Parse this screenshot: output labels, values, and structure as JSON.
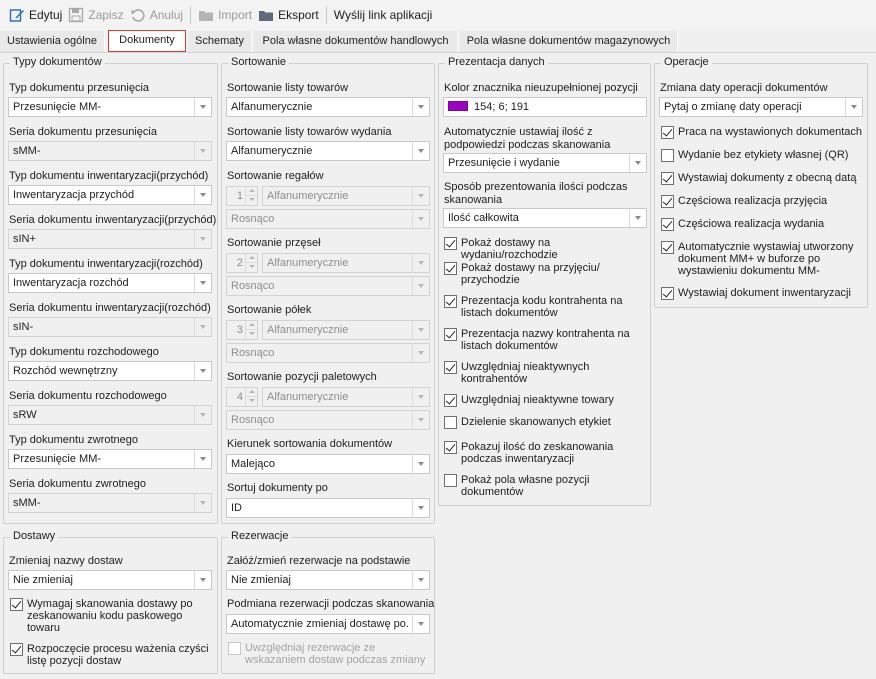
{
  "toolbar": {
    "edit": "Edytuj",
    "save": "Zapisz",
    "cancel": "Anuluj",
    "import": "Import",
    "export": "Eksport",
    "send_link": "Wyślij link aplikacji"
  },
  "tabs": [
    "Ustawienia ogólne",
    "Dokumenty",
    "Schematy",
    "Pola własne dokumentów handlowych",
    "Pola własne dokumentów magazynowych"
  ],
  "typy": {
    "legend": "Typy dokumentów",
    "f0": {
      "label": "Typ dokumentu przesunięcia",
      "value": "Przesunięcie MM-"
    },
    "f1": {
      "label": "Seria dokumentu przesunięcia",
      "value": "sMM-"
    },
    "f2": {
      "label": "Typ dokumentu inwentaryzacji(przychód)",
      "value": "Inwentaryzacja przychód"
    },
    "f3": {
      "label": "Seria dokumentu inwentaryzacji(przychód)",
      "value": "sIN+"
    },
    "f4": {
      "label": "Typ dokumentu inwentaryzacji(rozchód)",
      "value": "Inwentaryzacja rozchód"
    },
    "f5": {
      "label": "Seria dokumentu inwentaryzacji(rozchód)",
      "value": "sIN-"
    },
    "f6": {
      "label": "Typ dokumentu rozchodowego",
      "value": "Rozchód wewnętrzny"
    },
    "f7": {
      "label": "Seria dokumentu rozchodowego",
      "value": "sRW"
    },
    "f8": {
      "label": "Typ dokumentu zwrotnego",
      "value": "Przesunięcie MM-"
    },
    "f9": {
      "label": "Seria dokumentu zwrotnego",
      "value": "sMM-"
    }
  },
  "sort": {
    "legend": "Sortowanie",
    "l0": "Sortowanie listy towarów",
    "v0": "Alfanumerycznie",
    "l1": "Sortowanie listy towarów wydania",
    "v1": "Alfanumerycznie",
    "l2": "Sortowanie regałów",
    "n2": "1",
    "v2": "Alfanumerycznie",
    "o2": "Rosnąco",
    "l3": "Sortowanie przęseł",
    "n3": "2",
    "v3": "Alfanumerycznie",
    "o3": "Rosnąco",
    "l4": "Sortowanie półek",
    "n4": "3",
    "v4": "Alfanumerycznie",
    "o4": "Rosnąco",
    "l5": "Sortowanie pozycji paletowych",
    "n5": "4",
    "v5": "Alfanumerycznie",
    "o5": "Rosnąco",
    "l6": "Kierunek sortowania dokumentów",
    "v6": "Malejąco",
    "l7": "Sortuj dokumenty po",
    "v7": "ID"
  },
  "prez": {
    "legend": "Prezentacja danych",
    "color_label": "Kolor znacznika nieuzupełnionej pozycji",
    "color_value": "154; 6; 191",
    "color_hex": "#9a06bf",
    "auto_label": "Automatycznie ustawiaj ilość z podpowiedzi podczas skanowania",
    "auto_value": "Przesunięcie i wydanie",
    "qty_label": "Sposób prezentowania ilości podczas skanowania",
    "qty_value": "Ilość całkowita",
    "c0": "Pokaż dostawy na wydaniu/rozchodzie",
    "c1": "Pokaż dostawy na przyjęciu/ przychodzie",
    "c2": "Prezentacja kodu kontrahenta na listach dokumentów",
    "c3": "Prezentacja nazwy kontrahenta na listach dokumentów",
    "c4": "Uwzględniaj nieaktywnych kontrahentów",
    "c5": "Uwzględniaj nieaktywne towary",
    "c6": "Dzielenie skanowanych etykiet",
    "c7": "Pokazuj ilość do zeskanowania podczas inwentaryzacji",
    "c8": "Pokaż pola własne pozycji dokumentów"
  },
  "oper": {
    "legend": "Operacje",
    "date_label": "Zmiana daty operacji dokumentów",
    "date_value": "Pytaj o zmianę daty operacji",
    "c0": "Praca na wystawionych dokumentach",
    "c1": "Wydanie bez etykiety własnej (QR)",
    "c2": "Wystawiaj dokumenty z obecną datą",
    "c3": "Częściowa realizacja przyjęcia",
    "c4": "Częściowa realizacja wydania",
    "c5": "Automatycznie wystawiaj utworzony dokument MM+ w buforze po wystawieniu dokumentu MM-",
    "c6": "Wystawiaj dokument inwentaryzacji"
  },
  "dost": {
    "legend": "Dostawy",
    "label": "Zmieniaj nazwy dostaw",
    "value": "Nie zmieniaj",
    "c0": "Wymagaj skanowania dostawy po zeskanowaniu kodu paskowego towaru",
    "c1": "Rozpoczęcie procesu ważenia czyści listę pozycji dostaw"
  },
  "rez": {
    "legend": "Rezerwacje",
    "l0": "Załóż/zmień rezerwacje na podstawie",
    "v0": "Nie zmieniaj",
    "l1": "Podmiana rezerwacji podczas skanowania",
    "v1": "Automatycznie zmieniaj dostawę po...",
    "c0": "Uwzględniaj rezerwacje ze wskazaniem dostaw podczas zmiany"
  }
}
